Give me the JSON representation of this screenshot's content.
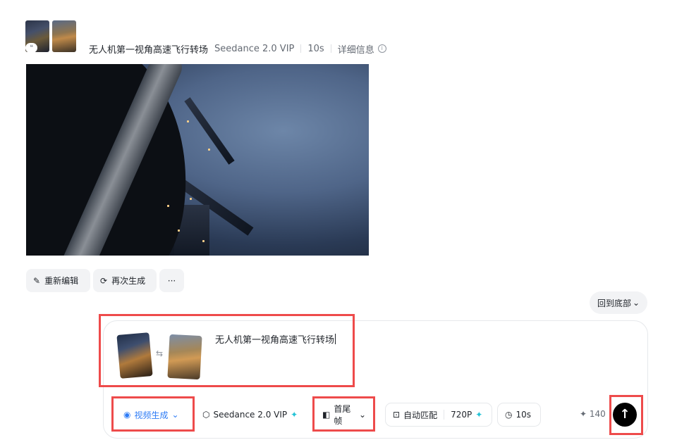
{
  "record": {
    "title": "无人机第一视角高速飞行转场",
    "model": "Seedance 2.0 VIP",
    "duration": "10s",
    "details": "详细信息"
  },
  "actions": {
    "reedit": "重新编辑",
    "regenerate": "再次生成",
    "more": "···"
  },
  "scroll_bottom": "回到底部",
  "composer": {
    "prompt": "无人机第一视角高速飞行转场",
    "mode": "视频生成",
    "model": "Seedance 2.0 VIP",
    "frame_mode": "首尾帧",
    "ratio": "自动匹配",
    "resolution": "720P",
    "duration": "10s",
    "credits": "140"
  },
  "icons": {
    "quote": "quote-icon",
    "info": "info-icon",
    "edit": "edit-icon",
    "refresh": "refresh-icon",
    "swap": "swap-icon",
    "cube": "cube-icon",
    "frame": "frame-icon",
    "ratio": "ratio-icon",
    "clock": "clock-icon",
    "sparkle": "sparkle-icon",
    "send": "arrow-up-icon"
  },
  "colors": {
    "accent": "#2e7cf6",
    "sparkle": "#24c3d6",
    "highlight": "#ee4b4b",
    "send": "#000000"
  }
}
